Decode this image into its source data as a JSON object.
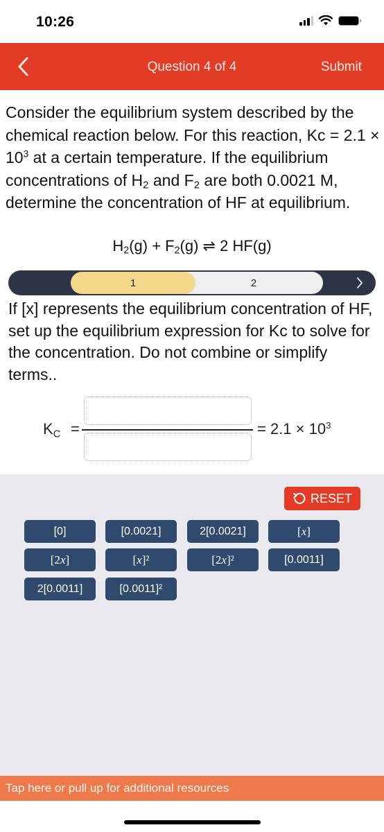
{
  "status_bar": {
    "time": "10:26",
    "icons": [
      "cellular-signal-icon",
      "wifi-icon",
      "battery-icon"
    ]
  },
  "nav": {
    "back_icon": "chevron-left-icon",
    "title": "Question 4 of 4",
    "submit_label": "Submit"
  },
  "question": {
    "line_parts": {
      "p1": "Consider the equilibrium system described by the chemical reaction below. For this reaction, Kc = 2.1 × 10",
      "p1_sup": "3",
      "p2": " at a certain temperature. If the equilibrium concentrations of H",
      "p2_sub": "2",
      "p3": " and F",
      "p3_sub": "2",
      "p4": " are both 0.0021 M, determine the concentration of HF at equilibrium."
    }
  },
  "reaction": {
    "r1": "H",
    "r1_sub": "2",
    "r1_state": "(g) + F",
    "r2_sub": "2",
    "r2_state": "(g) ⇌ 2 HF(g)"
  },
  "steps": {
    "items": [
      {
        "label": "1",
        "active": true
      },
      {
        "label": "2",
        "active": false
      }
    ],
    "next_icon": "chevron-right-icon"
  },
  "instruction": "If [x] represents the equilibrium concentration of HF, set up the equilibrium expression for Kc to solve for the concentration. Do not combine or simplify terms..",
  "equation": {
    "lhs": "K",
    "lhs_sub": "C",
    "equals": "=",
    "numerator_value": "",
    "denominator_value": "",
    "rhs": "= 2.1 × 10",
    "rhs_sup": "3"
  },
  "tiles": {
    "reset_label": "RESET",
    "reset_icon": "undo-icon",
    "items": [
      {
        "label": "[0]"
      },
      {
        "label": "[0.0021]"
      },
      {
        "label": "2[0.0021]"
      },
      {
        "label": "[x]",
        "pre": "[",
        "var": "x",
        "post": "]"
      },
      {
        "label": "[2x]",
        "pre": "[2",
        "var": "x",
        "post": "]"
      },
      {
        "label": "[x]²",
        "pre": "[",
        "var": "x",
        "post": "]²"
      },
      {
        "label": "[2x]²",
        "pre": "[2",
        "var": "x",
        "post": "]²"
      },
      {
        "label": "[0.0011]"
      },
      {
        "label": "2[0.0011]"
      },
      {
        "label": "[0.0011]²"
      }
    ]
  },
  "resources_bar": {
    "label": "Tap here or pull up for additional resources"
  },
  "colors": {
    "nav_red": "#e23b26",
    "step_bar_dark": "#2e3446",
    "step_active": "#f5d98b",
    "step_inactive": "#efefef",
    "tile_blue": "#2f4a6d",
    "panel_gray": "#e9e9ee",
    "resources_orange": "#ee7a4c"
  }
}
